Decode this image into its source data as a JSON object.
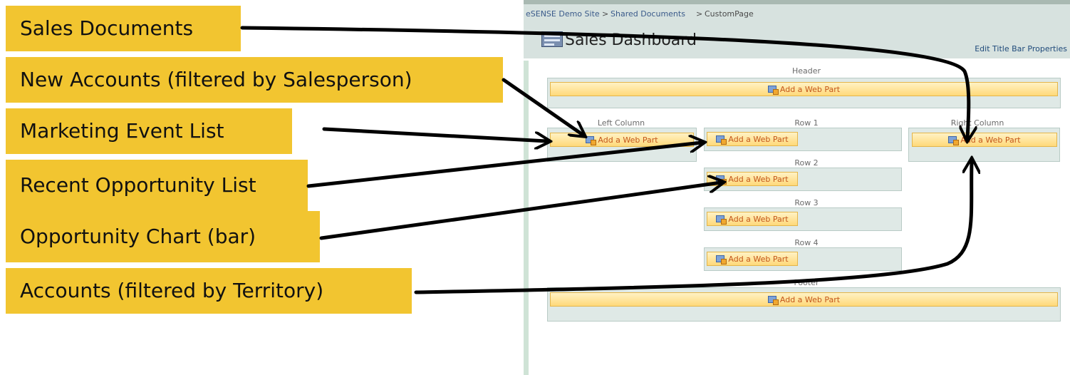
{
  "callouts": [
    {
      "text": "Sales Documents"
    },
    {
      "text": "New Accounts (filtered by Salesperson)"
    },
    {
      "text": "Marketing Event List"
    },
    {
      "text": "Recent Opportunity List"
    },
    {
      "text": "Opportunity Chart (bar)"
    },
    {
      "text": "Accounts (filtered by Territory)"
    }
  ],
  "breadcrumb": {
    "site": "eSENSE Demo Site",
    "sep1": ">",
    "library": "Shared Documents",
    "sep2": ">",
    "page": "CustomPage"
  },
  "page_title": "Sales Dashboard",
  "edit_title_bar": "Edit Title Bar Properties",
  "zones": {
    "header": "Header",
    "left_column": "Left Column",
    "row1": "Row 1",
    "right_column": "Right Column",
    "row2": "Row 2",
    "row3": "Row 3",
    "row4": "Row 4",
    "footer": "Footer"
  },
  "add_web_part_label": "Add a Web Part",
  "colors": {
    "callout_bg": "#f2c530",
    "arrow": "#000000",
    "title_bar_bg": "#d7e2df",
    "add_button_text": "#c4561b"
  },
  "icons": {
    "page_title_icon": "web-part-page-icon",
    "add_web_part_icon": "add-web-part-icon"
  }
}
